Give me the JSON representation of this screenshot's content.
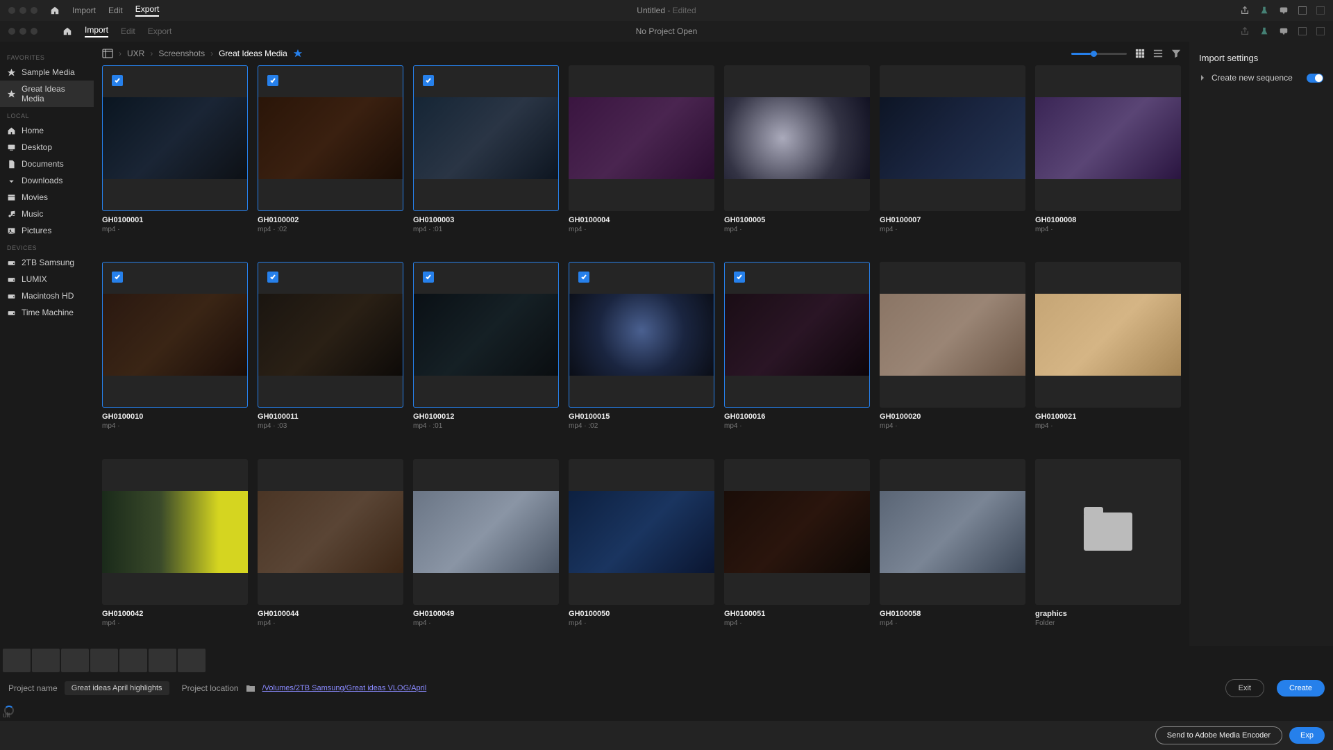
{
  "topbar": {
    "tabs": [
      "Import",
      "Edit",
      "Export"
    ],
    "active": 2,
    "title": "Untitled",
    "title_suffix": " - Edited"
  },
  "secondbar": {
    "tabs": [
      "Import",
      "Edit",
      "Export"
    ],
    "active": 0,
    "title": "No Project Open"
  },
  "sidebar": {
    "sections": [
      {
        "head": "FAVORITES",
        "items": [
          {
            "icon": "star",
            "label": "Sample Media",
            "sel": false
          },
          {
            "icon": "star",
            "label": "Great Ideas Media",
            "sel": true
          }
        ]
      },
      {
        "head": "LOCAL",
        "items": [
          {
            "icon": "home",
            "label": "Home"
          },
          {
            "icon": "desktop",
            "label": "Desktop"
          },
          {
            "icon": "doc",
            "label": "Documents"
          },
          {
            "icon": "down",
            "label": "Downloads"
          },
          {
            "icon": "movie",
            "label": "Movies"
          },
          {
            "icon": "music",
            "label": "Music"
          },
          {
            "icon": "pic",
            "label": "Pictures"
          }
        ]
      },
      {
        "head": "DEVICES",
        "items": [
          {
            "icon": "drive",
            "label": "2TB Samsung"
          },
          {
            "icon": "drive",
            "label": "LUMIX"
          },
          {
            "icon": "drive",
            "label": "Macintosh HD"
          },
          {
            "icon": "drive",
            "label": "Time Machine"
          }
        ]
      }
    ]
  },
  "breadcrumb": [
    "UXR",
    "Screenshots",
    "Great Ideas Media"
  ],
  "clips": [
    {
      "name": "GH0100001",
      "meta": "mp4 · ",
      "sel": true,
      "g": "g1"
    },
    {
      "name": "GH0100002",
      "meta": "mp4 · :02",
      "sel": true,
      "g": "g2"
    },
    {
      "name": "GH0100003",
      "meta": "mp4 · :01",
      "sel": true,
      "g": "g3"
    },
    {
      "name": "GH0100004",
      "meta": "mp4 ·",
      "sel": false,
      "g": "g4"
    },
    {
      "name": "GH0100005",
      "meta": "mp4 ·",
      "sel": false,
      "g": "g5"
    },
    {
      "name": "GH0100007",
      "meta": "mp4 ·",
      "sel": false,
      "g": "g6"
    },
    {
      "name": "GH0100008",
      "meta": "mp4 ·",
      "sel": false,
      "g": "g7"
    },
    {
      "name": "GH0100010",
      "meta": "mp4 ·",
      "sel": true,
      "g": "g8"
    },
    {
      "name": "GH0100011",
      "meta": "mp4 · :03",
      "sel": true,
      "g": "g9"
    },
    {
      "name": "GH0100012",
      "meta": "mp4 · :01",
      "sel": true,
      "g": "g10"
    },
    {
      "name": "GH0100015",
      "meta": "mp4 · :02",
      "sel": true,
      "g": "g11"
    },
    {
      "name": "GH0100016",
      "meta": "mp4 ·",
      "sel": true,
      "g": "g12"
    },
    {
      "name": "GH0100020",
      "meta": "mp4 ·",
      "sel": false,
      "g": "g13"
    },
    {
      "name": "GH0100021",
      "meta": "mp4 ·",
      "sel": false,
      "g": "g14"
    },
    {
      "name": "GH0100042",
      "meta": "mp4 ·",
      "sel": false,
      "g": "g15"
    },
    {
      "name": "GH0100044",
      "meta": "mp4 ·",
      "sel": false,
      "g": "g16"
    },
    {
      "name": "GH0100049",
      "meta": "mp4 ·",
      "sel": false,
      "g": "g17"
    },
    {
      "name": "GH0100050",
      "meta": "mp4 ·",
      "sel": false,
      "g": "g18"
    },
    {
      "name": "GH0100051",
      "meta": "mp4 ·",
      "sel": false,
      "g": "g19"
    },
    {
      "name": "GH0100058",
      "meta": "mp4 ·",
      "sel": false,
      "g": "g20"
    },
    {
      "name": "graphics",
      "meta": "Folder",
      "sel": false,
      "folder": true
    }
  ],
  "rightpanel": {
    "title": "Import settings",
    "seq_label": "Create new sequence"
  },
  "strip_count": 7,
  "bottombar": {
    "pname_label": "Project name",
    "pname_value": "Great ideas April highlights",
    "ploc_label": "Project location",
    "ploc_value": "/Volumes/2TB Samsung/Great ideas VLOG/April",
    "exit": "Exit",
    "create": "Create"
  },
  "footer": {
    "encoder": "Send to Adobe Media Encoder",
    "export": "Exp",
    "ult": "ult"
  }
}
